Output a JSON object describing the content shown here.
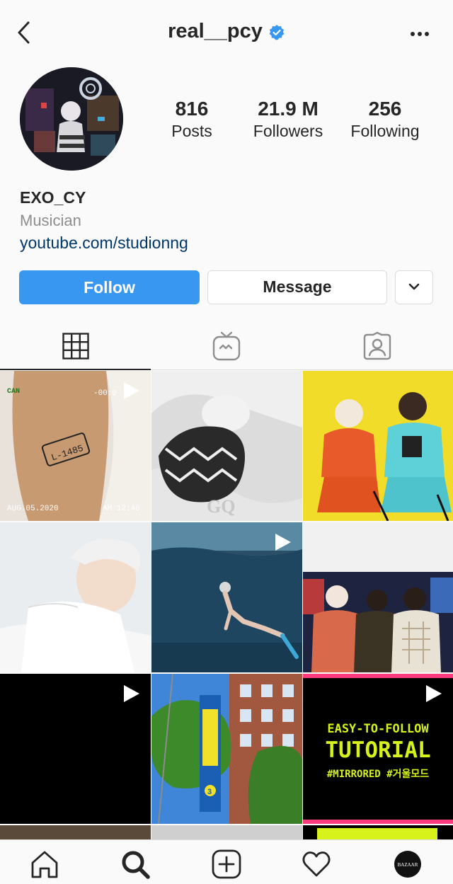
{
  "header": {
    "username": "real__pcy",
    "back_icon": "chevron-left-icon",
    "verified_icon": "verified-badge-icon",
    "more_icon": "more-horizontal-icon"
  },
  "stats": [
    {
      "value": "816",
      "label": "Posts"
    },
    {
      "value": "21.9 M",
      "label": "Followers"
    },
    {
      "value": "256",
      "label": "Following"
    }
  ],
  "bio": {
    "name": "EXO_CY",
    "category": "Musician",
    "link": "youtube.com/studionng"
  },
  "actions": {
    "follow_label": "Follow",
    "message_label": "Message",
    "dropdown_icon": "chevron-down-icon"
  },
  "tabs": [
    {
      "icon": "grid-icon",
      "active": true
    },
    {
      "icon": "igtv-icon",
      "active": false
    },
    {
      "icon": "tagged-icon",
      "active": false
    }
  ],
  "posts": {
    "p1": {
      "stamp_top": "CAN",
      "timer": "-00:0",
      "tag": "L-1485",
      "date": "AUG.05.2020",
      "time": "AM 12:46"
    },
    "p2": {
      "watermark": "GQ"
    },
    "p8": {
      "sign_text": "3"
    },
    "p9": {
      "line1": "EASY-TO-FOLLOW",
      "line2": "TUTORIAL",
      "line3": "#MIRRORED #거울모드"
    },
    "video_posts": [
      1,
      5,
      7,
      9
    ]
  },
  "bottom_nav": {
    "items": [
      "home-icon",
      "search-icon",
      "new-post-icon",
      "activity-heart-icon",
      "profile-avatar-icon"
    ],
    "profile_avatar_text": "BAZAAR"
  },
  "colors": {
    "accent": "#3897f0",
    "link": "#00376b",
    "muted": "#8e8e8e",
    "tutorial_yellow": "#d6f21a",
    "tutorial_pink": "#ff3b7f"
  }
}
